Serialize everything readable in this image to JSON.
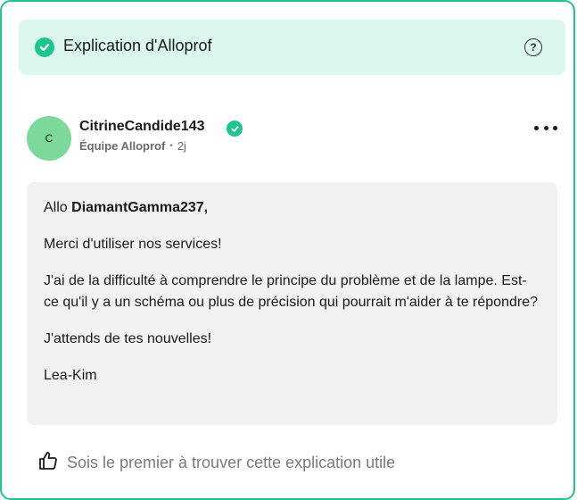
{
  "banner": {
    "title": "Explication d'Alloprof",
    "check_icon": "check-circle-icon",
    "help_icon": "help-circle-icon",
    "help_symbol": "?"
  },
  "author": {
    "avatar_initial": "C",
    "username": "CitrineCandide143",
    "team": "Équipe Alloprof",
    "separator": "•",
    "time": "2j",
    "verified_icon": "verified-check-icon",
    "avatar_color": "#7dd99b"
  },
  "menu": {
    "icon": "more-horizontal-icon"
  },
  "message": {
    "greeting_prefix": "Allo",
    "greeting_name": "DiamantGamma237,",
    "paragraph_1": "Merci d'utiliser nos services!",
    "paragraph_2": "J'ai de la difficulté à comprendre le principe du problème et de la lampe. Est-ce qu'il y a un schéma ou plus de précision qui pourrait m'aider à te répondre?",
    "paragraph_3": "J'attends de tes nouvelles!",
    "signature": "Lea-Kim"
  },
  "footer": {
    "like_icon": "thumbs-up-icon",
    "like_text": "Sois le premier à trouver cette explication utile"
  },
  "colors": {
    "accent": "#1fc58e",
    "banner_bg": "#dcf7ee",
    "message_bg": "#f2f2f2"
  }
}
